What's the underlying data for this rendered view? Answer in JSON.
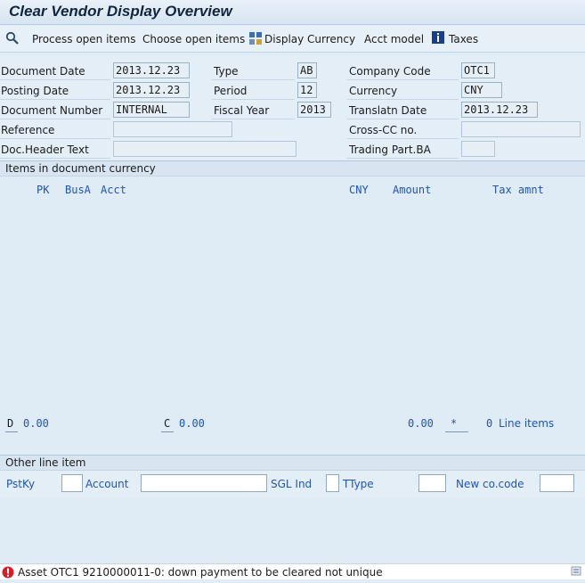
{
  "window": {
    "title": "Clear Vendor Display Overview"
  },
  "toolbar": {
    "process_open_items": "Process open items",
    "choose_open_items": "Choose open items",
    "display_currency": "Display Currency",
    "acct_model": "Acct model",
    "taxes": "Taxes"
  },
  "header": {
    "document_date": {
      "label": "Document Date",
      "value": "2013.12.23"
    },
    "posting_date": {
      "label": "Posting Date",
      "value": "2013.12.23"
    },
    "document_number": {
      "label": "Document Number",
      "value": "INTERNAL"
    },
    "reference": {
      "label": "Reference",
      "value": ""
    },
    "doc_header_text": {
      "label": "Doc.Header Text",
      "value": ""
    },
    "type": {
      "label": "Type",
      "value": "AB"
    },
    "period": {
      "label": "Period",
      "value": "12"
    },
    "fiscal_year": {
      "label": "Fiscal Year",
      "value": "2013"
    },
    "company_code": {
      "label": "Company Code",
      "value": "OTC1"
    },
    "currency": {
      "label": "Currency",
      "value": "CNY"
    },
    "translatn_date": {
      "label": "Translatn Date",
      "value": "2013.12.23"
    },
    "cross_cc_no": {
      "label": "Cross-CC no.",
      "value": ""
    },
    "trading_part_ba": {
      "label": "Trading Part.BA",
      "value": ""
    }
  },
  "items_section": {
    "title": "Items in document currency",
    "columns": {
      "pk": "PK",
      "busa": "BusA",
      "acct": "Acct",
      "cny": "CNY",
      "amount": "Amount",
      "tax_amnt": "Tax amnt"
    },
    "totals": {
      "d_label": "D",
      "d_value": "0.00",
      "c_label": "C",
      "c_value": "0.00",
      "balance": "0.00",
      "star": "*",
      "line_items_count": "0",
      "line_items_label": "Line items"
    }
  },
  "other_line_item": {
    "title": "Other line item",
    "pstky": "PstKy",
    "account": "Account",
    "sgl_ind": "SGL Ind",
    "ttype": "TType",
    "new_co_code": "New co.code"
  },
  "status_bar": {
    "message": "Asset OTC1 9210000011-0: down payment to be cleared not unique"
  },
  "colors": {
    "accent_blue": "#1f55b5",
    "error_red": "#d0202a"
  }
}
